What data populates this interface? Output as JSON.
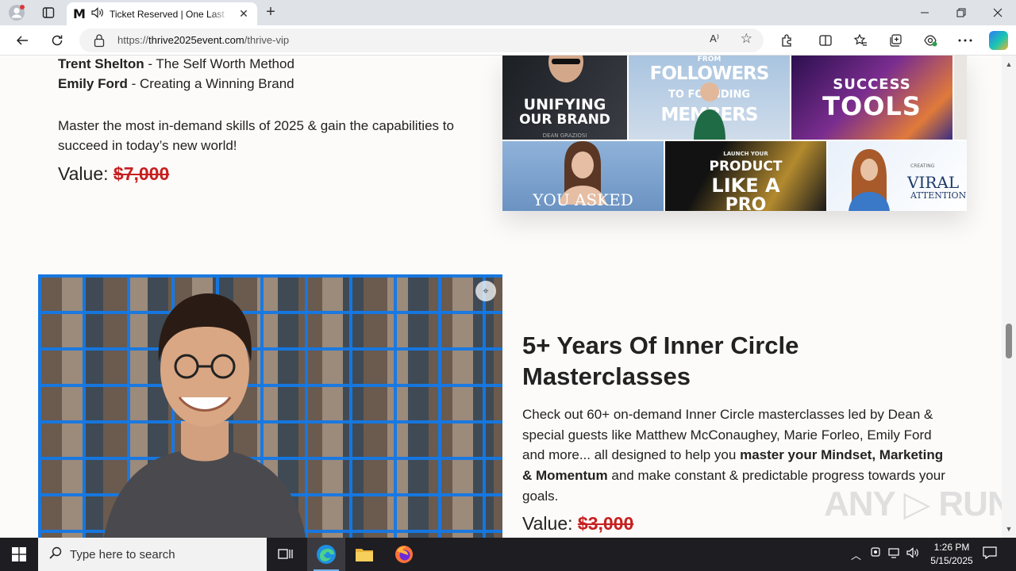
{
  "browser": {
    "tab_title": "Ticket Reserved | One Last Step",
    "favicon_letter": "M",
    "url_prefix": "https://",
    "url_domain": "thrive2025event.com",
    "url_path": "/thrive-vip",
    "read_aloud_label": "A⁾",
    "new_tab": "+"
  },
  "section1": {
    "speakers": [
      {
        "name": "Trent Shelton",
        "topic": " - The Self Worth Method"
      },
      {
        "name": "Emily Ford",
        "topic": " - Creating a Winning Brand"
      }
    ],
    "description": "Master the most in-demand skills of 2025 & gain the capabilities to succeed in today’s new world!",
    "value_label": "Value: ",
    "value_price": "$7,000",
    "collage": {
      "tile1_line1": "UNIFYING",
      "tile1_line2": "OUR BRAND",
      "tile1_small": "DEAN GRAZIOSI",
      "tile2_line1": "FROM",
      "tile2_line2": "FOLLOWERS",
      "tile2_line3": "TO FOUNDING",
      "tile2_line4": "MEMBERS",
      "tile3_line1": "SUCCESS",
      "tile3_line2": "TOOLS",
      "tile4_text": "YOU ASKED",
      "tile5_small": "LAUNCH YOUR",
      "tile5_line1": "PRODUCT",
      "tile5_line2": "LIKE A",
      "tile5_line3": "PRO",
      "tile6_small": "CREATING",
      "tile6_line1": "VIRAL",
      "tile6_line2": "ATTENTION"
    }
  },
  "section2": {
    "heading": "5+ Years Of Inner Circle Masterclasses",
    "desc_part1": "Check out 60+ on-demand Inner Circle masterclasses led by Dean & special guests like Matthew McConaughey, Marie Forleo, Emily Ford and more... all designed to help you ",
    "desc_bold": "master your Mindset, Marketing & Momentum",
    "desc_part2": " and make constant & predictable progress towards your goals.",
    "value_label": "Value: ",
    "value_price": "$3,000"
  },
  "watermark": "ANY ▷ RUN",
  "taskbar": {
    "search_placeholder": "Type here to search",
    "time": "1:26 PM",
    "date": "5/15/2025"
  }
}
